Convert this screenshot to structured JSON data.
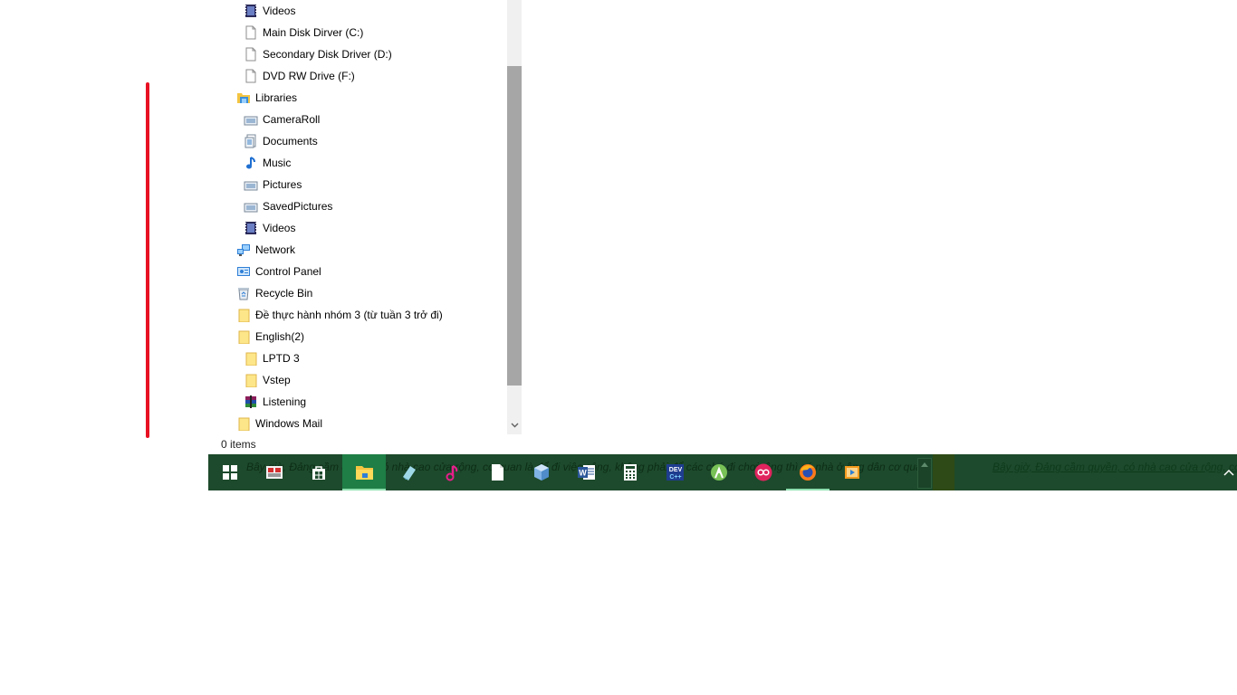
{
  "nav": {
    "items": [
      {
        "label": "Videos",
        "icon": "video-icon"
      },
      {
        "label": "Main Disk Dirver  (C:)",
        "icon": "drive-icon"
      },
      {
        "label": "Secondary Disk Driver (D:)",
        "icon": "drive-icon"
      },
      {
        "label": "DVD RW Drive (F:)",
        "icon": "drive-icon"
      },
      {
        "label": "Libraries",
        "icon": "libraries-icon"
      },
      {
        "label": "CameraRoll",
        "icon": "pictures-library-icon"
      },
      {
        "label": "Documents",
        "icon": "documents-icon"
      },
      {
        "label": "Music",
        "icon": "music-icon"
      },
      {
        "label": "Pictures",
        "icon": "pictures-library-icon"
      },
      {
        "label": "SavedPictures",
        "icon": "pictures-library-icon"
      },
      {
        "label": "Videos",
        "icon": "video-icon"
      },
      {
        "label": "Network",
        "icon": "network-icon"
      },
      {
        "label": "Control Panel",
        "icon": "control-panel-icon"
      },
      {
        "label": "Recycle Bin",
        "icon": "recycle-bin-icon"
      },
      {
        "label": "Đề thực hành nhóm 3 (từ tuần 3 trở đi)",
        "icon": "folder-icon"
      },
      {
        "label": "English(2)",
        "icon": "folder-icon"
      },
      {
        "label": "LPTD 3",
        "icon": "folder-icon"
      },
      {
        "label": "Vstep",
        "icon": "folder-icon"
      },
      {
        "label": "Listening",
        "icon": "winrar-archive-icon"
      },
      {
        "label": "Windows Mail",
        "icon": "folder-icon"
      }
    ]
  },
  "status_bar": {
    "item_count": "0 items"
  },
  "taskbar": {
    "background_text": "Bây giờ, Đảng cầm quyền, có nhà cao cửa rộng, cơ quan là để đi việc công, không phải để các chú đi chơi, ông thì có nhà ở ông dân cơ quan",
    "background_text_right": "Bây giờ, Đảng cầm quyền, có nhà cao cửa rộng, cơ quan là để đi việc công, không phải để",
    "apps": [
      {
        "name": "start",
        "icon": "windows-start-icon"
      },
      {
        "name": "unikey",
        "icon": "unikey-icon"
      },
      {
        "name": "store",
        "icon": "store-icon"
      },
      {
        "name": "file-explorer",
        "icon": "file-explorer-icon"
      },
      {
        "name": "eraser",
        "icon": "eraser-icon"
      },
      {
        "name": "music",
        "icon": "music-app-icon"
      },
      {
        "name": "notepad",
        "icon": "blank-document-icon"
      },
      {
        "name": "3d",
        "icon": "cube-icon"
      },
      {
        "name": "word",
        "icon": "word-icon"
      },
      {
        "name": "calculator",
        "icon": "calculator-icon"
      },
      {
        "name": "dev-cpp",
        "icon": "dev-cpp-icon"
      },
      {
        "name": "android-studio",
        "icon": "android-studio-icon"
      },
      {
        "name": "flickr",
        "icon": "flickr-icon"
      },
      {
        "name": "firefox",
        "icon": "firefox-icon"
      },
      {
        "name": "media-player",
        "icon": "media-player-icon"
      }
    ]
  },
  "colors": {
    "taskbar_bg": "#1d4a2c",
    "active_app_bg": "#1e7e45",
    "red_marker": "#e81123",
    "scroll_thumb": "#a6a6a6"
  }
}
